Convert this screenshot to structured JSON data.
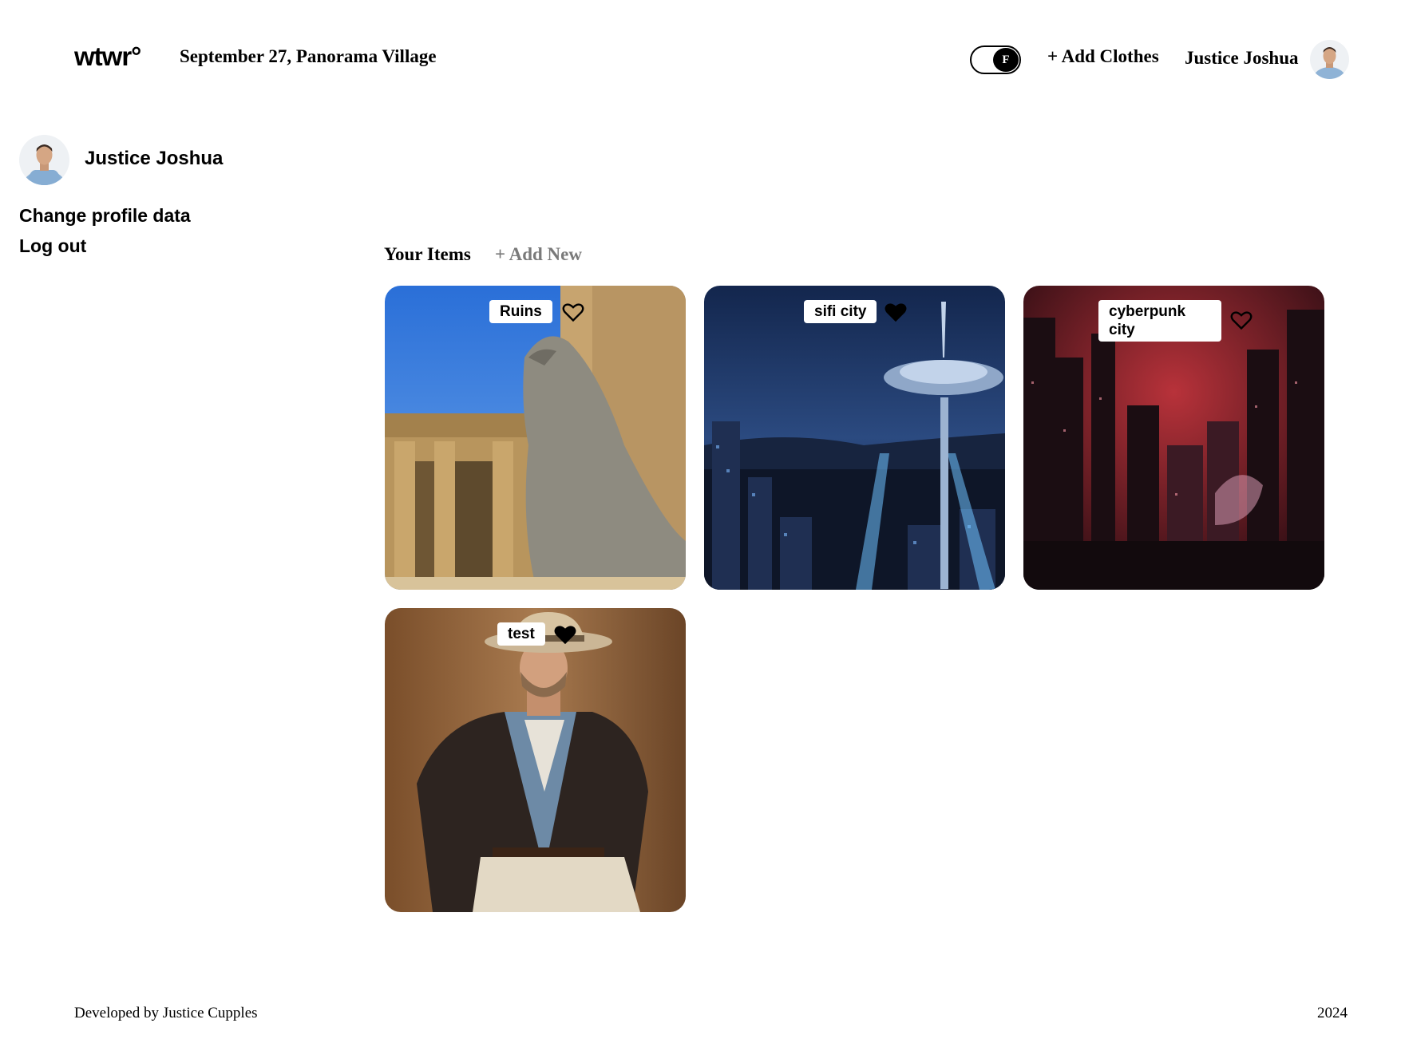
{
  "header": {
    "logo_text": "wtwr°",
    "date_location": "September 27, Panorama Village",
    "temp_unit_toggle": "F",
    "add_clothes_label": "+ Add Clothes",
    "user_name": "Justice Joshua",
    "avatar_icon": "user-avatar-icon"
  },
  "sidebar": {
    "user_name": "Justice Joshua",
    "links": [
      {
        "label": "Change profile data"
      },
      {
        "label": "Log out"
      }
    ]
  },
  "items": {
    "title": "Your Items",
    "add_new_label": "+ Add New",
    "cards": [
      {
        "name": "Ruins",
        "liked": false,
        "image": "egyptian-temple-statue"
      },
      {
        "name": "sifi city",
        "liked": true,
        "image": "scifi-city-night"
      },
      {
        "name": "cyberpunk city",
        "liked": false,
        "image": "cyberpunk-red-city"
      },
      {
        "name": "test",
        "liked": true,
        "image": "man-in-hat-jacket"
      }
    ]
  },
  "footer": {
    "credit": "Developed by Justice Cupples",
    "year": "2024"
  },
  "colors": {
    "background": "#ffffff",
    "text": "#000000",
    "muted": "#7a7a7a"
  }
}
